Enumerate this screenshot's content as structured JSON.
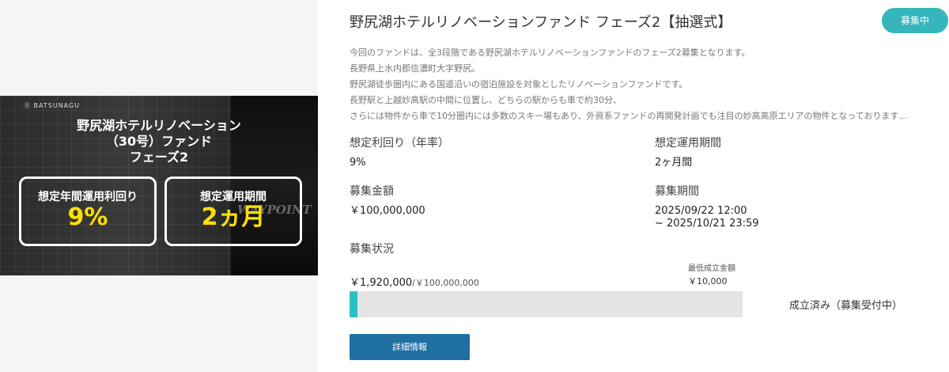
{
  "banner": {
    "logo": "Ⓢ BATSUNAGU",
    "title_lines": [
      "野尻湖ホテルリノベーション",
      "（30号）ファンド",
      "フェーズ2"
    ],
    "box1_label": "想定年間運用利回り",
    "box1_value": "9%",
    "box2_label": "想定運用期間",
    "box2_value": "2ヵ月",
    "watermark": "WAYPOINT"
  },
  "fund": {
    "title": "野尻湖ホテルリノベーションファンド フェーズ2【抽選式】",
    "status": "募集中",
    "description": [
      "今回のファンドは、全3段階である野尻湖ホテルリノベーションファンドのフェーズ2募集となります。",
      "長野県上水内郡信濃町大字野尻。",
      "野尻湖徒歩圏内にある国道沿いの宿泊施設を対象としたリノベーションファンドです。",
      "長野駅と上越妙高駅の中間に位置し、どちらの駅からも車で約30分、",
      "さらには物件から車で10分圏内には多数のスキー場もあり、外資系ファンドの再開発計画でも注目の妙高高原エリアの物件となっております..."
    ]
  },
  "details": {
    "yield_label": "想定利回り（年率）",
    "yield_value": "9%",
    "period_label": "想定運用期間",
    "period_value": "2ヶ月間",
    "amount_label": "募集金額",
    "amount_value": "￥100,000,000",
    "recruit_label": "募集期間",
    "recruit_start": "2025/09/22 12:00",
    "recruit_end": "~ 2025/10/21 23:59"
  },
  "progress": {
    "section_label": "募集状況",
    "raised": "￥1,920,000",
    "target": "/￥100,000,000",
    "min_label": "最低成立金額",
    "min_value": "￥10,000",
    "percent": 1.92,
    "fill_color": "#2cc0c6",
    "result": "成立済み（募集受付中）"
  },
  "actions": {
    "detail_label": "詳細情報"
  }
}
